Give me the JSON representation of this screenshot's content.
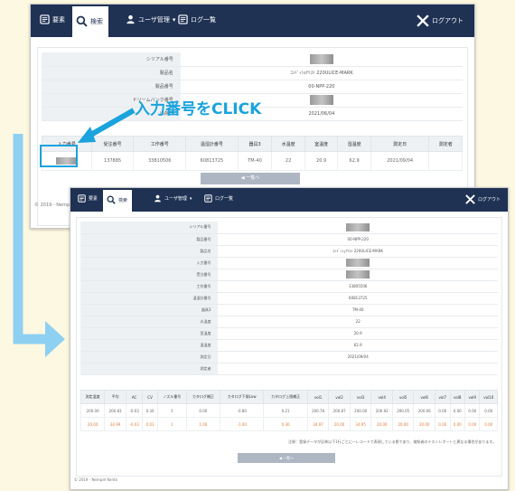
{
  "nav": {
    "list_label": "要素",
    "search_label": "検索",
    "user_label": "ユーザ管理",
    "log_label": "ログ一覧",
    "logout_label": "ログアウト"
  },
  "screen1": {
    "details": [
      {
        "label": "シリアル番号",
        "value": "",
        "redacted": true
      },
      {
        "label": "製品名",
        "value": "ｺﾝﾄﾞｨｼｮﾅﾘｽﾄ 220ULICE-MARK",
        "redacted": false
      },
      {
        "label": "製品番号",
        "value": "00-NPP-220",
        "redacted": false
      },
      {
        "label": "ドリームバンク番号",
        "value": "",
        "redacted": true
      },
      {
        "label": "出荷日",
        "value": "2021/06/04",
        "redacted": false
      }
    ],
    "table": {
      "headers": [
        "入力番号",
        "受注番号",
        "工作番号",
        "温湿計番号",
        "器具3",
        "水温度",
        "室温度",
        "湿温度",
        "測定日",
        "測定者"
      ],
      "row": [
        "",
        "137885",
        "33810506",
        "60813725",
        "TM-40",
        "22",
        "20.9",
        "62.9",
        "2021/09/04",
        ""
      ]
    },
    "back_label": "一覧へ",
    "footer": "© 2019 - Nempet"
  },
  "callout": {
    "text": "入力番号をCLICK",
    "accent": "#1aa3dc"
  },
  "screen2": {
    "details": [
      {
        "label": "シリアル番号",
        "value": "",
        "redacted": true
      },
      {
        "label": "製品番号",
        "value": "00-NPP-220",
        "redacted": false
      },
      {
        "label": "製品名",
        "value": "ｺﾝﾄﾞｨｼｮﾅﾘｽﾄ 220ULICE-MARK",
        "redacted": false
      },
      {
        "label": "入力番号",
        "value": "",
        "redacted": true
      },
      {
        "label": "受注番号",
        "value": "",
        "redacted": true
      },
      {
        "label": "工作番号",
        "value": "33805506",
        "redacted": false
      },
      {
        "label": "温湿計番号",
        "value": "60813725",
        "redacted": false
      },
      {
        "label": "器具3",
        "value": "TM-40",
        "redacted": false
      },
      {
        "label": "水温度",
        "value": "22",
        "redacted": false
      },
      {
        "label": "室温度",
        "value": "20.9",
        "redacted": false
      },
      {
        "label": "湿温度",
        "value": "62.9",
        "redacted": false
      },
      {
        "label": "測定日",
        "value": "2021/09/04",
        "redacted": false
      },
      {
        "label": "測定者",
        "value": "",
        "redacted": false
      }
    ],
    "table": {
      "headers": [
        "測定温度",
        "平均",
        "AC",
        "CV",
        "ノズル番号",
        "カタログ補正",
        "カタログ下限Low",
        "カタログ上限補正",
        "vol1",
        "vol2",
        "vol3",
        "vol4",
        "vol5",
        "vol6",
        "vol7",
        "vol8",
        "vol9",
        "vol10"
      ],
      "rows": [
        [
          "200.00",
          "200.83",
          "-0.03",
          "0.30",
          "1",
          "0.00",
          "-0.80",
          "0.21",
          "200.78",
          "200.87",
          "200.00",
          "200.92",
          "200.05",
          "200.06",
          "0.00",
          "0.00",
          "0.00",
          "0.00"
        ],
        [
          "20.00",
          "34.99",
          "-0.03",
          "0.03",
          "1",
          "1.00",
          "-1.00",
          "0.30",
          "34.97",
          "20.00",
          "34.95",
          "20.00",
          "20.00",
          "20.00",
          "0.00",
          "0.00",
          "0.00",
          "0.00"
        ]
      ]
    },
    "note": "注釈：登録データが反映以下1行ごとに一レコードで表現している態であり、検知者のテストレポートと異なる場合があります。",
    "back_label": "一覧へ",
    "footer": "© 2019 - Nempet Kento"
  }
}
